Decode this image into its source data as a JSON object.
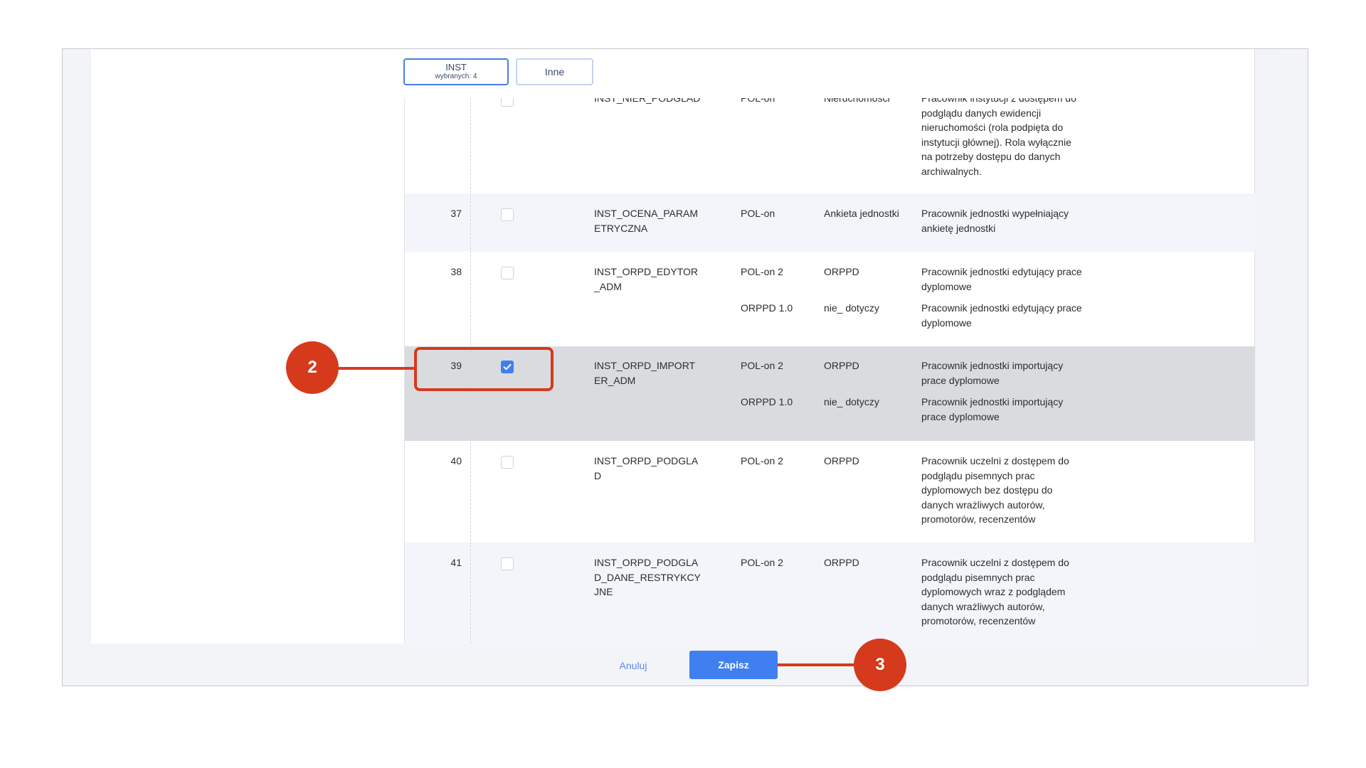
{
  "tabs": [
    {
      "label": "INST",
      "sub": "wybranych: 4"
    },
    {
      "label": "Inne"
    }
  ],
  "rows": [
    {
      "num": "",
      "code": "INST_NIER_PODGLAD",
      "checked": false,
      "lines": [
        {
          "sys": "POL-on",
          "mod": "Nieruchomości",
          "desc": "Pracownik instytucji z dostępem do podglądu danych ewidencji nieruchomości (rola podpięta do instytucji głównej). Rola wyłącznie na potrzeby dostępu do danych archiwalnych."
        }
      ]
    },
    {
      "num": "37",
      "code": "INST_OCENA_PARAMETRYCZNA",
      "checked": false,
      "lines": [
        {
          "sys": "POL-on",
          "mod": "Ankieta jednostki",
          "desc": "Pracownik jednostki wypełniający ankietę jednostki"
        }
      ]
    },
    {
      "num": "38",
      "code": "INST_ORPD_EDYTOR_ADM",
      "checked": false,
      "lines": [
        {
          "sys": "POL-on 2",
          "mod": "ORPPD",
          "desc": "Pracownik jednostki edytujący prace dyplomowe"
        },
        {
          "sys": "ORPPD 1.0",
          "mod": "nie_ dotyczy",
          "desc": "Pracownik jednostki edytujący prace dyplomowe"
        }
      ]
    },
    {
      "num": "39",
      "code": "INST_ORPD_IMPORTER_ADM",
      "checked": true,
      "lines": [
        {
          "sys": "POL-on 2",
          "mod": "ORPPD",
          "desc": "Pracownik jednostki importujący prace dyplomowe"
        },
        {
          "sys": "ORPPD 1.0",
          "mod": "nie_ dotyczy",
          "desc": "Pracownik jednostki importujący prace dyplomowe"
        }
      ]
    },
    {
      "num": "40",
      "code": "INST_ORPD_PODGLAD",
      "checked": false,
      "lines": [
        {
          "sys": "POL-on 2",
          "mod": "ORPPD",
          "desc": "Pracownik uczelni z dostępem do podglądu pisemnych prac dyplomowych bez dostępu do danych wrażliwych autorów, promotorów, recenzentów"
        }
      ]
    },
    {
      "num": "41",
      "code": "INST_ORPD_PODGLAD_DANE_RESTRYKCYJNE",
      "checked": false,
      "lines": [
        {
          "sys": "POL-on 2",
          "mod": "ORPPD",
          "desc": "Pracownik uczelni z dostępem do podglądu pisemnych prac dyplomowych wraz z podglądem danych wrażliwych autorów, promotorów, recenzentów"
        }
      ]
    }
  ],
  "buttons": {
    "cancel": "Anuluj",
    "save": "Zapisz"
  },
  "callouts": {
    "a": "2",
    "b": "3"
  },
  "colors": {
    "accent": "#3f7ff0",
    "callout": "#d53a1c",
    "selected_row": "#dadbdf"
  }
}
